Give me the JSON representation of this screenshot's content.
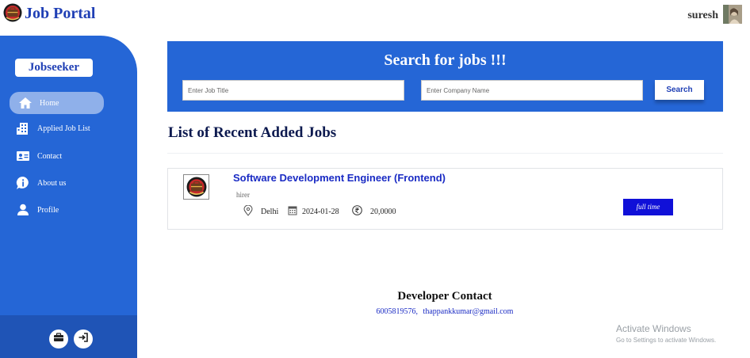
{
  "header": {
    "brand": "Job Portal",
    "user_name": "suresh"
  },
  "sidebar": {
    "role": "Jobseeker",
    "items": [
      {
        "label": "Home",
        "icon": "home-icon",
        "active": true
      },
      {
        "label": "Applied Job List",
        "icon": "building-icon",
        "active": false
      },
      {
        "label": "Contact",
        "icon": "contact-card-icon",
        "active": false
      },
      {
        "label": "About us",
        "icon": "info-icon",
        "active": false
      },
      {
        "label": "Profile",
        "icon": "user-icon",
        "active": false
      }
    ],
    "bottom_buttons": [
      "briefcase-icon",
      "logout-icon"
    ]
  },
  "search": {
    "title": "Search for jobs !!!",
    "job_title_placeholder": "Enter Job Title",
    "company_placeholder": "Enter Company Name",
    "button_label": "Search"
  },
  "list": {
    "title": "List of Recent Added Jobs",
    "jobs": [
      {
        "title": "Software Development Engineer (Frontend)",
        "company": "hirer",
        "location": "Delhi",
        "date": "2024-01-28",
        "salary": "20,0000",
        "type": "full time"
      }
    ]
  },
  "footer": {
    "title": "Developer Contact",
    "phone": "6005819576,",
    "email": "thappankkumar@gmail.com"
  },
  "watermark": {
    "title": "Activate Windows",
    "subtitle": "Go to Settings to activate Windows."
  },
  "colors": {
    "primary": "#2566d6",
    "sidebar_bottom": "#1f54b6",
    "brand_text": "#1f3fb5",
    "job_title": "#1a2bc4",
    "badge": "#1010d8"
  }
}
